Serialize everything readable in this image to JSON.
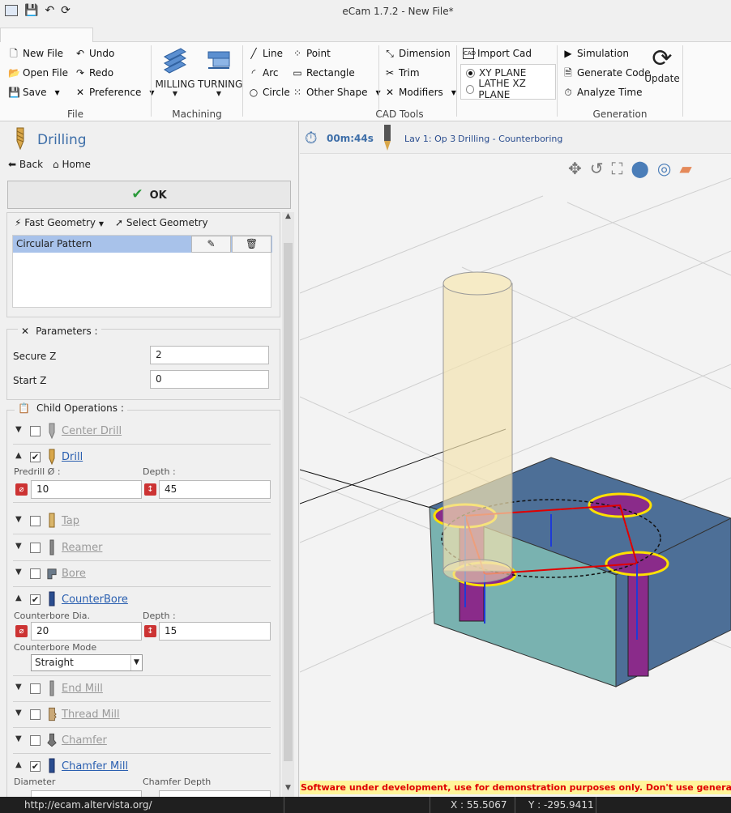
{
  "window": {
    "title": "eCam 1.7.2 - New File*"
  },
  "ribbon": {
    "file": {
      "new_file": "New File",
      "open_file": "Open File",
      "save": "Save",
      "undo": "Undo",
      "redo": "Redo",
      "preference": "Preference",
      "label": "File"
    },
    "machining": {
      "milling": "MILLING",
      "turning": "TURNING",
      "label": "Machining"
    },
    "cad_tools": {
      "line": "Line",
      "arc": "Arc",
      "circle": "Circle",
      "point": "Point",
      "rectangle": "Rectangle",
      "other_shape": "Other Shape",
      "dimension": "Dimension",
      "trim": "Trim",
      "modifiers": "Modifiers",
      "import_cad": "Import Cad",
      "xy_plane": "XY PLANE",
      "lathe_xz_plane": "LATHE XZ PLANE",
      "label": "CAD Tools"
    },
    "generation": {
      "simulation": "Simulation",
      "generate_code": "Generate Code",
      "analyze_time": "Analyze Time",
      "update": "Update",
      "label": "Generation"
    }
  },
  "panel": {
    "title": "Drilling",
    "back": "Back",
    "home": "Home",
    "ok": "OK",
    "fast_geometry": "Fast Geometry",
    "select_geometry": "Select Geometry",
    "geometry_items": [
      "Circular Pattern"
    ],
    "parameters_header": "Parameters :",
    "secure_z_label": "Secure Z",
    "secure_z_value": "2",
    "start_z_label": "Start Z",
    "start_z_value": "0",
    "child_ops_header": "Child Operations :",
    "ops": {
      "center_drill": "Center Drill",
      "drill": "Drill",
      "tap": "Tap",
      "reamer": "Reamer",
      "bore": "Bore",
      "counterbore": "CounterBore",
      "end_mill": "End Mill",
      "thread_mill": "Thread Mill",
      "chamfer": "Chamfer",
      "chamfer_mill": "Chamfer Mill"
    },
    "drill": {
      "predrill_label": "Predrill Ø :",
      "predrill_value": "10",
      "depth_label": "Depth :",
      "depth_value": "45"
    },
    "counterbore": {
      "dia_label": "Counterbore Dia.",
      "dia_value": "20",
      "depth_label": "Depth :",
      "depth_value": "15",
      "mode_label": "Counterbore Mode",
      "mode_value": "Straight"
    },
    "chamfer_mill": {
      "diameter_label": "Diameter",
      "chamfer_depth_label": "Chamfer Depth"
    }
  },
  "viewport": {
    "time": "00m:44s",
    "lav": "Lav 1: Op 3",
    "operation": "Drilling - Counterboring"
  },
  "dev_warning": "Software under development, use for demonstration purposes only. Don't use generated g-code",
  "status": {
    "url": "http://ecam.altervista.org/",
    "x": "X : 55.5067",
    "y": "Y : -295.9411"
  },
  "colors": {
    "accent": "#3d6ea8",
    "selection": "#a8c2ea",
    "warning_bg": "#fff59a",
    "warning_text": "#e00000"
  }
}
